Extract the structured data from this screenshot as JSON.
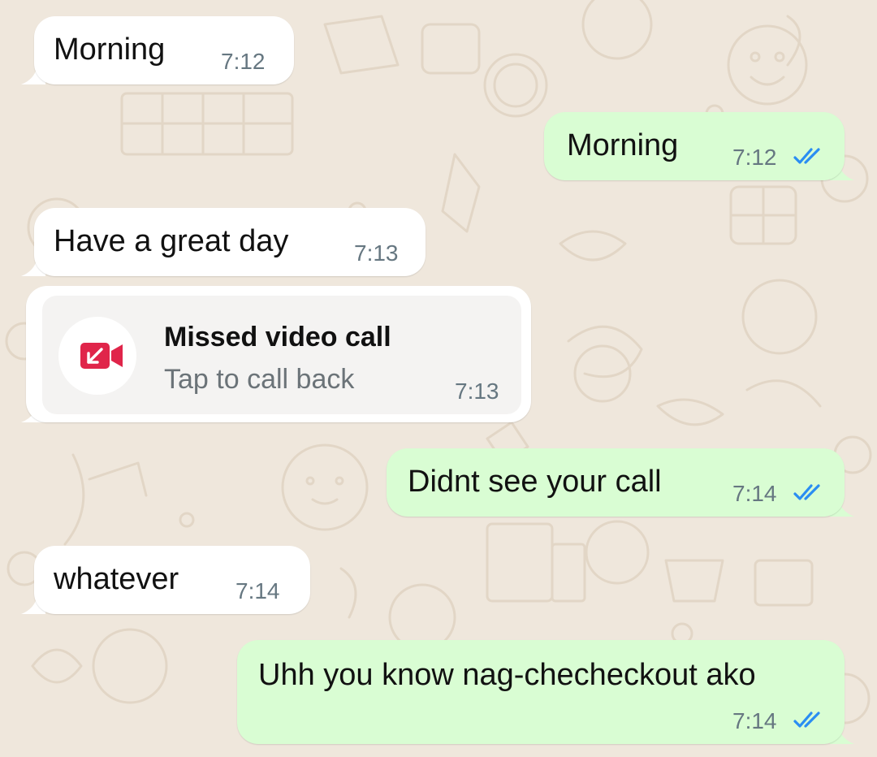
{
  "messages": [
    {
      "direction": "incoming",
      "text": "Morning",
      "time": "7:12"
    },
    {
      "direction": "outgoing",
      "text": "Morning",
      "time": "7:12",
      "status": "read-double-check-icon"
    },
    {
      "direction": "incoming",
      "text": "Have a great day",
      "time": "7:13"
    },
    {
      "direction": "incoming",
      "type": "call",
      "title": "Missed video call",
      "subtitle": "Tap to call back",
      "time": "7:13",
      "icon": "missed-video-call-icon"
    },
    {
      "direction": "outgoing",
      "text": "Didnt see your call",
      "time": "7:14",
      "status": "read-double-check-icon"
    },
    {
      "direction": "incoming",
      "text": "whatever",
      "time": "7:14"
    },
    {
      "direction": "outgoing",
      "text": "Uhh you know nag-checheckout ako",
      "time": "7:14",
      "status": "read-double-check-icon"
    }
  ],
  "colors": {
    "wallpaper": "#efe7dc",
    "incoming_bubble": "#ffffff",
    "outgoing_bubble": "#d9fdd3",
    "read_ticks": "#2a8df2",
    "missed_call": "#e0254a"
  }
}
